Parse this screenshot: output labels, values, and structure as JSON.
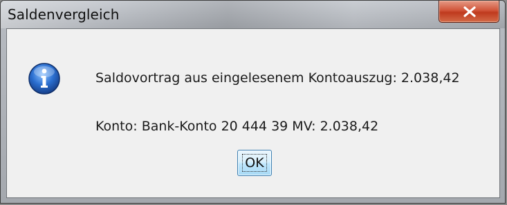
{
  "window": {
    "title": "Saldenvergleich"
  },
  "dialog": {
    "icon": "info-icon",
    "message_line1": "Saldovortrag aus eingelesenem Kontoauszug: 2.038,42",
    "message_line2": "Konto: Bank-Konto 20 444 39 MV: 2.038,42",
    "ok_label": "OK"
  },
  "colors": {
    "close_button": "#c8432a",
    "info_icon": "#1f5fb8",
    "client_background": "#f0f0f0"
  }
}
